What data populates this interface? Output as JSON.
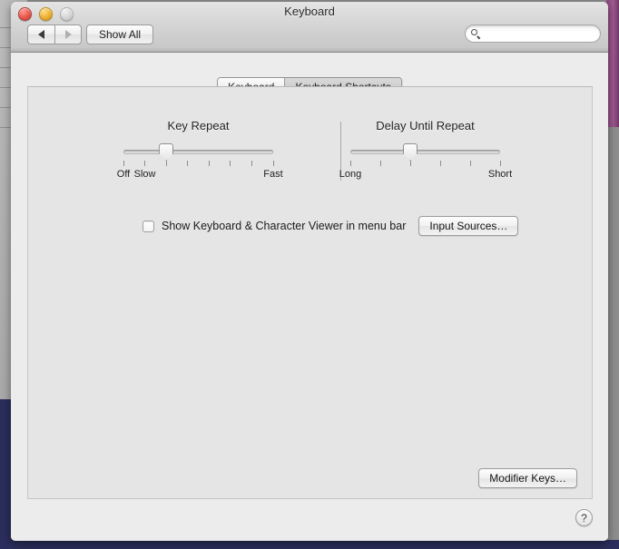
{
  "window": {
    "title": "Keyboard",
    "traffic_lights": [
      {
        "name": "close",
        "color": "#e8564b"
      },
      {
        "name": "minimize",
        "color": "#eeb02f"
      },
      {
        "name": "zoom",
        "color": "#d6d6d6"
      }
    ]
  },
  "toolbar": {
    "back_label": "◀",
    "forward_label": "▶",
    "show_all_label": "Show All",
    "search": {
      "icon": "search-icon",
      "value": "",
      "placeholder": ""
    }
  },
  "tabs": [
    {
      "label": "Keyboard",
      "selected": true
    },
    {
      "label": "Keyboard Shortcuts",
      "selected": false
    }
  ],
  "key_repeat": {
    "title": "Key Repeat",
    "tick_count": 8,
    "value_index": 2,
    "labels": [
      {
        "text": "Off",
        "tick": 0
      },
      {
        "text": "Slow",
        "tick": 1
      },
      {
        "text": "Fast",
        "tick": 7
      }
    ]
  },
  "delay_until_repeat": {
    "title": "Delay Until Repeat",
    "tick_count": 6,
    "value_index": 2,
    "labels": [
      {
        "text": "Long",
        "tick": 0
      },
      {
        "text": "Short",
        "tick": 5
      }
    ]
  },
  "show_viewer": {
    "label": "Show Keyboard & Character Viewer in menu bar",
    "checked": false
  },
  "buttons": {
    "input_sources": "Input Sources…",
    "modifier_keys": "Modifier Keys…",
    "help": "?"
  },
  "colors": {
    "window_bg": "#ececec",
    "content_bg": "#e5e5e5",
    "desktop": "#2b2d5c",
    "accent_strip": "#a05a92"
  }
}
